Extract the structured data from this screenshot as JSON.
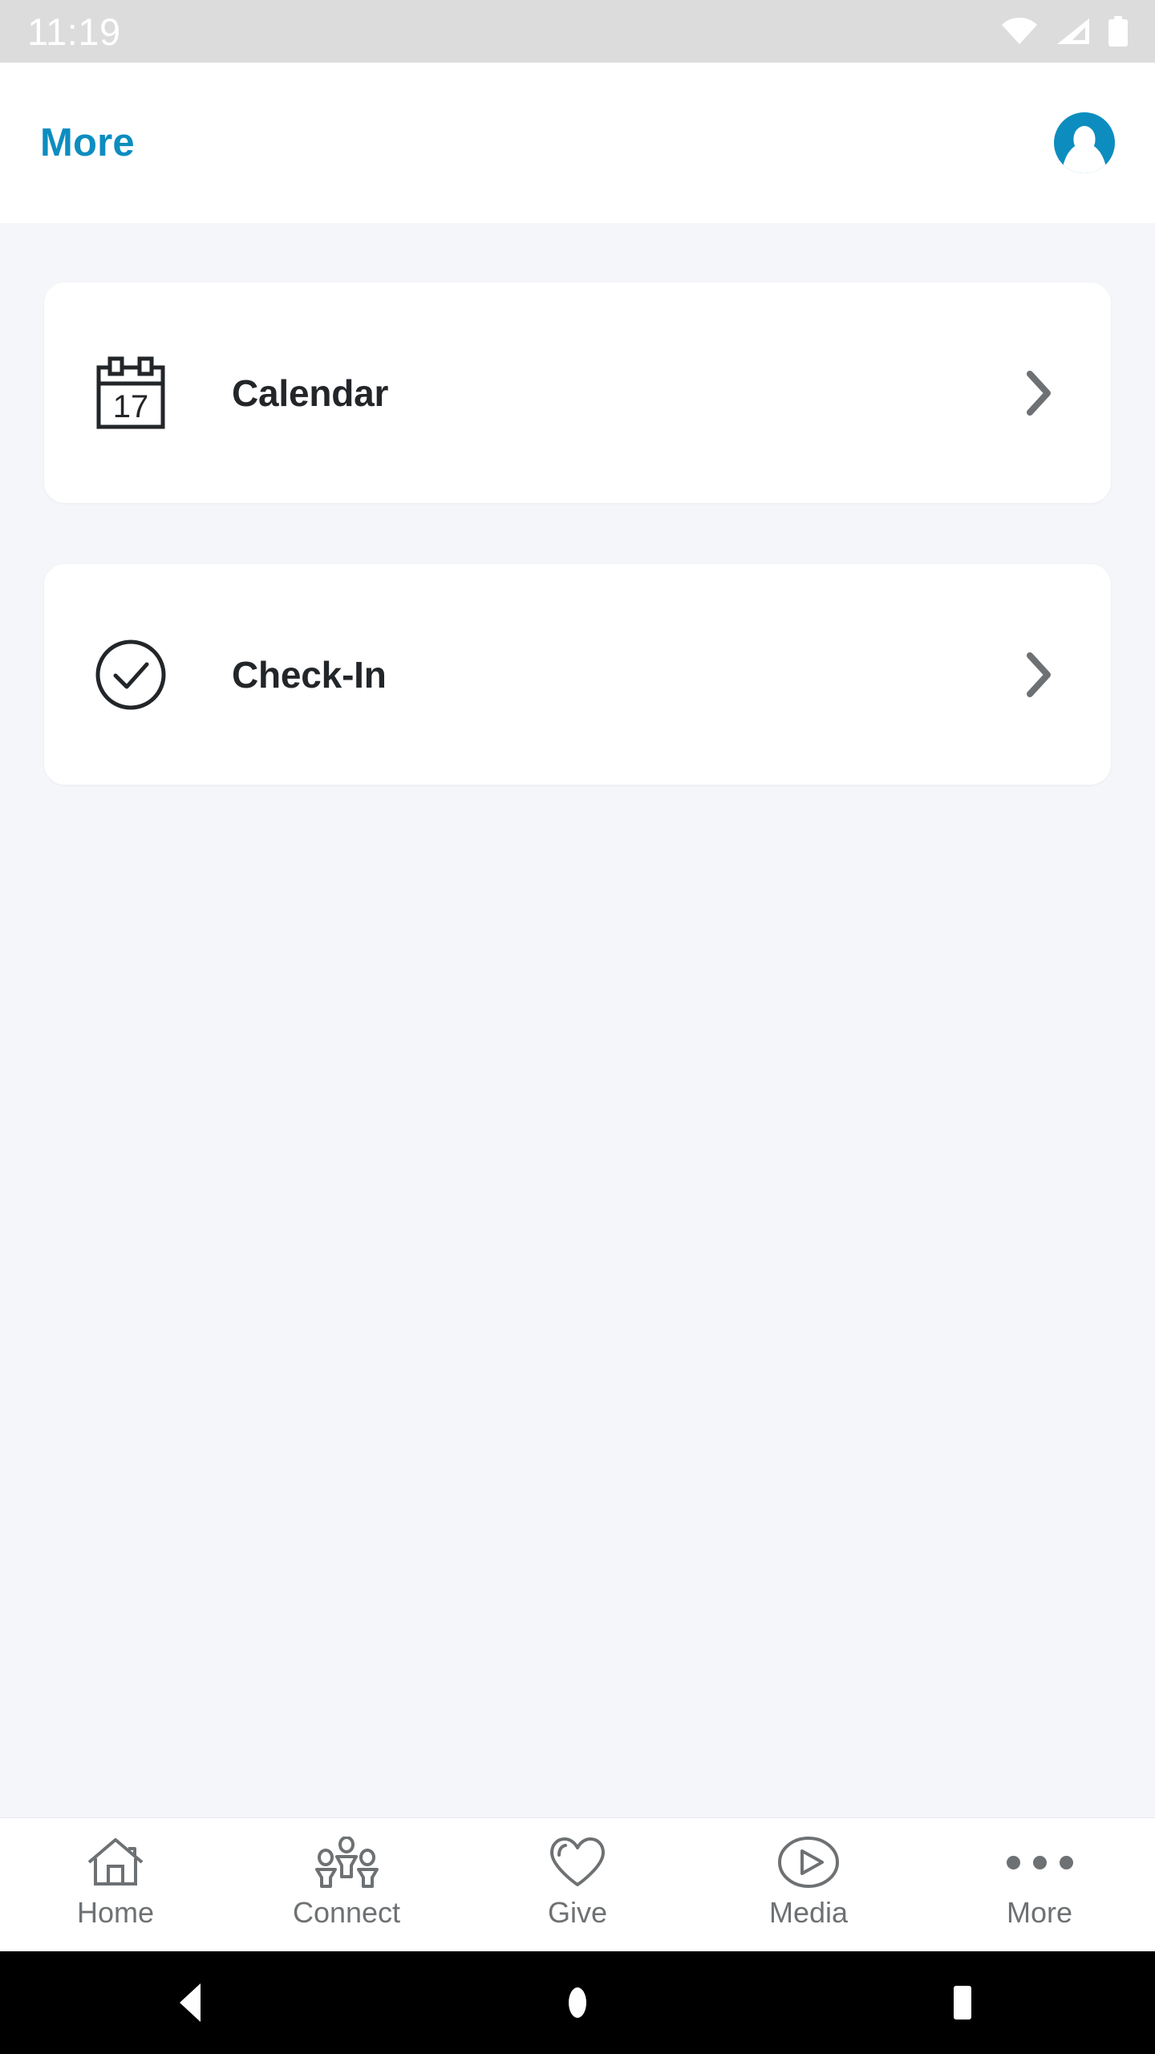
{
  "status_bar": {
    "time": "11:19",
    "icons": [
      "wifi-icon",
      "cellular-signal-icon",
      "battery-icon"
    ],
    "background_color": "#dcdcdc",
    "text_color": "#ffffff"
  },
  "header": {
    "title": "More",
    "title_color": "#0d8dbf",
    "avatar_icon": "user-avatar-icon",
    "avatar_color": "#0d8dbf"
  },
  "content": {
    "background_color": "#f4f6f9",
    "cards": [
      {
        "label": "Calendar",
        "icon": "calendar-17-icon",
        "chevron": "chevron-right-icon"
      },
      {
        "label": "Check-In",
        "icon": "check-circle-icon",
        "chevron": "chevron-right-icon"
      }
    ]
  },
  "bottom_nav": {
    "items": [
      {
        "label": "Home",
        "icon": "home-icon"
      },
      {
        "label": "Connect",
        "icon": "people-group-icon"
      },
      {
        "label": "Give",
        "icon": "heart-icon"
      },
      {
        "label": "Media",
        "icon": "play-circle-icon"
      },
      {
        "label": "More",
        "icon": "ellipsis-icon"
      }
    ],
    "icon_color": "#6e7173",
    "label_color": "#6e7173"
  },
  "android_nav": {
    "buttons": [
      "back-button",
      "home-button",
      "recents-button"
    ],
    "background_color": "#000000"
  }
}
